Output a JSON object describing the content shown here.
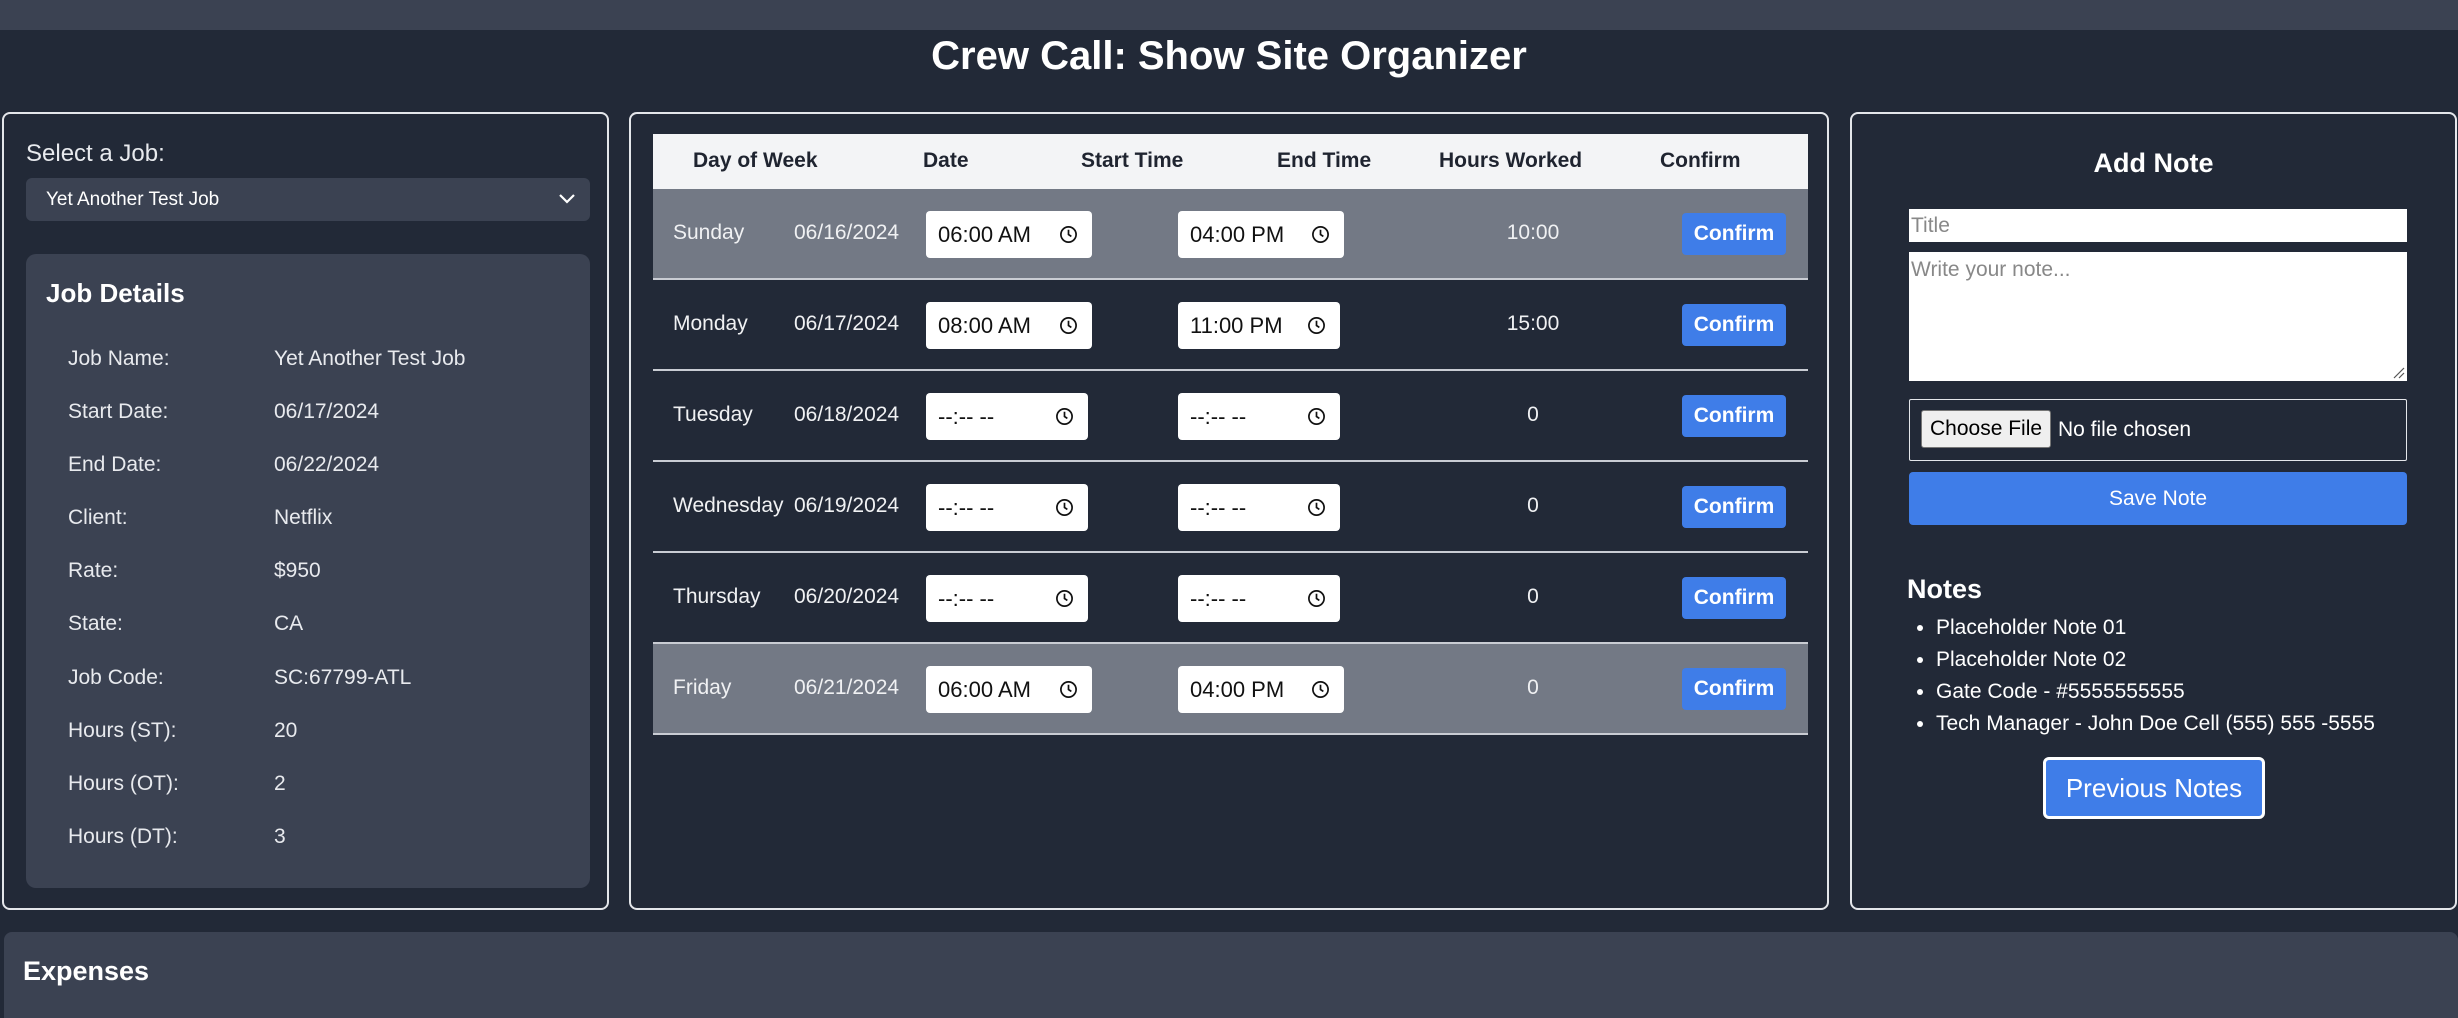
{
  "app": {
    "title": "Crew Call: Show Site Organizer"
  },
  "job_select": {
    "label": "Select a Job:",
    "selected": "Yet Another Test Job"
  },
  "job_details": {
    "title": "Job Details",
    "rows": [
      {
        "label": "Job Name:",
        "value": "Yet Another Test Job"
      },
      {
        "label": "Start Date:",
        "value": "06/17/2024"
      },
      {
        "label": "End Date:",
        "value": "06/22/2024"
      },
      {
        "label": "Client:",
        "value": "Netflix"
      },
      {
        "label": "Rate:",
        "value": "$950"
      },
      {
        "label": "State:",
        "value": "CA"
      },
      {
        "label": "Job Code:",
        "value": "SC:67799-ATL"
      },
      {
        "label": "Hours (ST):",
        "value": "20"
      },
      {
        "label": "Hours (OT):",
        "value": "2"
      },
      {
        "label": "Hours (DT):",
        "value": "3"
      }
    ]
  },
  "timesheet": {
    "headers": [
      "Day of Week",
      "Date",
      "Start Time",
      "End Time",
      "Hours Worked",
      "Confirm"
    ],
    "rows": [
      {
        "day": "Sunday",
        "date": "06/16/2024",
        "start": "06:00  AM",
        "end": "04:00  PM",
        "hours": "10:00",
        "confirm": "Confirm",
        "highlight": true
      },
      {
        "day": "Monday",
        "date": "06/17/2024",
        "start": "08:00  AM",
        "end": "11:00  PM",
        "hours": "15:00",
        "confirm": "Confirm",
        "highlight": false
      },
      {
        "day": "Tuesday",
        "date": "06/18/2024",
        "start": "--:-- --",
        "end": "--:-- --",
        "hours": "0",
        "confirm": "Confirm",
        "highlight": false
      },
      {
        "day": "Wednesday",
        "date": "06/19/2024",
        "start": "--:-- --",
        "end": "--:-- --",
        "hours": "0",
        "confirm": "Confirm",
        "highlight": false
      },
      {
        "day": "Thursday",
        "date": "06/20/2024",
        "start": "--:-- --",
        "end": "--:-- --",
        "hours": "0",
        "confirm": "Confirm",
        "highlight": false
      },
      {
        "day": "Friday",
        "date": "06/21/2024",
        "start": "06:00  AM",
        "end": "04:00  PM",
        "hours": "0",
        "confirm": "Confirm",
        "highlight": true
      }
    ]
  },
  "add_note": {
    "title": "Add Note",
    "title_placeholder": "Title",
    "body_placeholder": "Write your note...",
    "file_button": "Choose File",
    "file_status": "No file chosen",
    "save_label": "Save Note"
  },
  "notes": {
    "title": "Notes",
    "items": [
      "Placeholder Note 01",
      "Placeholder Note 02",
      "Gate Code - #5555555555",
      "Tech Manager - John Doe Cell (555) 555 -5555"
    ],
    "previous_label": "Previous Notes"
  },
  "expenses": {
    "title": "Expenses"
  },
  "colors": {
    "background": "#222937",
    "panel_alt": "#3b4252",
    "accent": "#3f7de8",
    "row_highlight": "#737985"
  }
}
